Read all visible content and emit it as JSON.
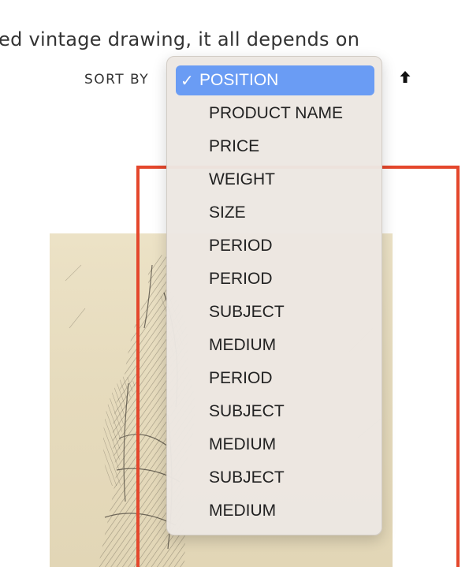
{
  "intro": {
    "text": "ed vintage drawing, it all depends on"
  },
  "sort": {
    "label": "SORT BY",
    "direction_icon": "arrow-up-icon",
    "selected_check": "✓",
    "options": [
      {
        "label": "POSITION",
        "selected": true
      },
      {
        "label": "PRODUCT NAME",
        "selected": false
      },
      {
        "label": "PRICE",
        "selected": false
      },
      {
        "label": "WEIGHT",
        "selected": false
      },
      {
        "label": "SIZE",
        "selected": false
      },
      {
        "label": "PERIOD",
        "selected": false
      },
      {
        "label": "PERIOD",
        "selected": false
      },
      {
        "label": "SUBJECT",
        "selected": false
      },
      {
        "label": "MEDIUM",
        "selected": false
      },
      {
        "label": "PERIOD",
        "selected": false
      },
      {
        "label": "SUBJECT",
        "selected": false
      },
      {
        "label": "MEDIUM",
        "selected": false
      },
      {
        "label": "SUBJECT",
        "selected": false
      },
      {
        "label": "MEDIUM",
        "selected": false
      }
    ]
  },
  "colors": {
    "selected_option": "#6a9cf4",
    "highlight_border": "#e4472c",
    "dropdown_bg": "#ece7e2"
  }
}
